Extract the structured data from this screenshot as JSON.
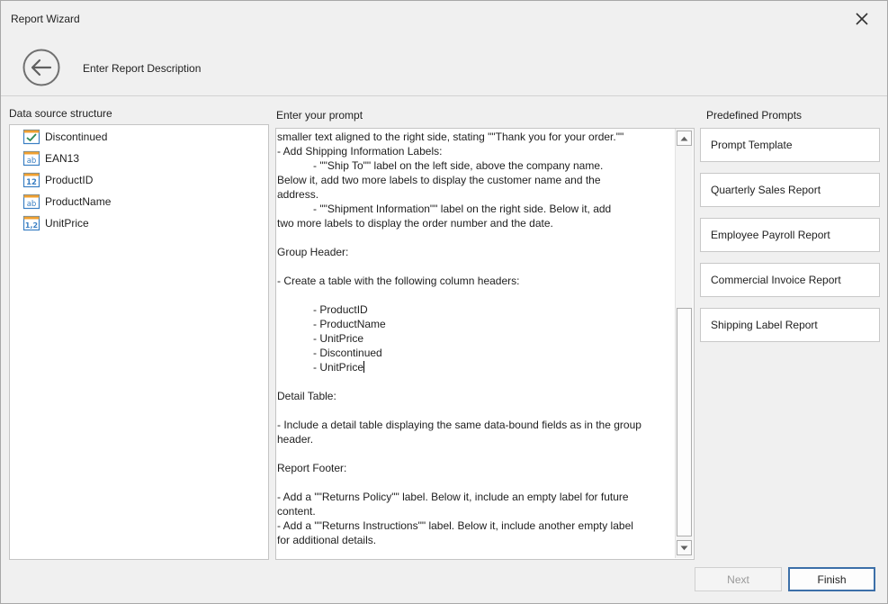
{
  "window": {
    "title": "Report Wizard"
  },
  "step": {
    "title": "Enter Report Description"
  },
  "data_source": {
    "label": "Data source structure",
    "items": [
      {
        "label": "Discontinued",
        "icon": "checkbox-field-icon"
      },
      {
        "label": "EAN13",
        "icon": "text-field-icon"
      },
      {
        "label": "ProductID",
        "icon": "integer-field-icon"
      },
      {
        "label": "ProductName",
        "icon": "text-field-icon"
      },
      {
        "label": "UnitPrice",
        "icon": "decimal-field-icon"
      }
    ]
  },
  "prompt": {
    "label": "Enter your prompt",
    "lines": [
      "smaller text aligned to the right side, stating \"\"Thank you for your order.\"\"",
      "- Add Shipping Information Labels:",
      "            - \"\"Ship To\"\" label on the left side, above the company name.",
      "Below it, add two more labels to display the customer name and the",
      "address.",
      "            - \"\"Shipment Information\"\" label on the right side. Below it, add",
      "two more labels to display the order number and the date.",
      "",
      "Group Header:",
      "",
      "- Create a table with the following column headers:",
      "",
      "            - ProductID",
      "            - ProductName",
      "            - UnitPrice",
      "            - Discontinued",
      "            - UnitPrice",
      "",
      "Detail Table:",
      "",
      "- Include a detail table displaying the same data-bound fields as in the group",
      "header.",
      "",
      "Report Footer:",
      "",
      "- Add a \"\"Returns Policy\"\" label. Below it, include an empty label for future",
      "content.",
      "- Add a \"\"Returns Instructions\"\" label. Below it, include another empty label",
      "for additional details."
    ],
    "caret_line": 16
  },
  "predefined": {
    "label": "Predefined Prompts",
    "items": [
      "Prompt Template",
      "Quarterly Sales Report",
      "Employee Payroll Report",
      "Commercial Invoice Report",
      "Shipping Label Report"
    ]
  },
  "buttons": {
    "next": "Next",
    "finish": "Finish"
  },
  "colors": {
    "accent": "#3c6fa8",
    "icon_blue": "#3a7fc3",
    "icon_check": "#2e8b57",
    "icon_orange": "#f0a030"
  }
}
